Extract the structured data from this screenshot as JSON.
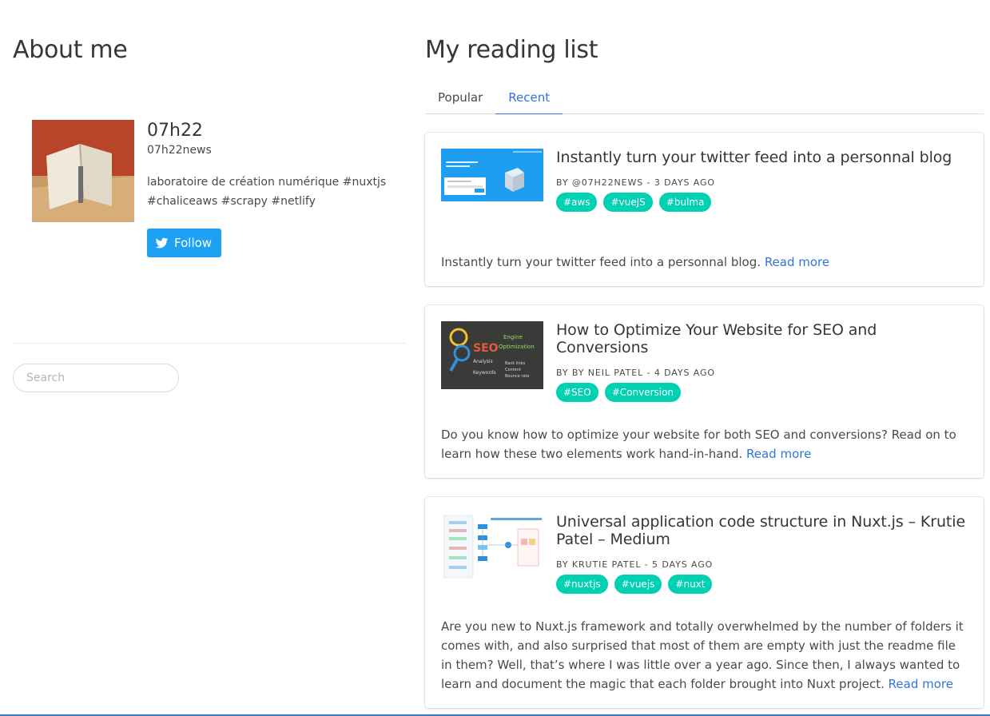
{
  "about": {
    "title": "About me",
    "name": "07h22",
    "handle": "07h22news",
    "bio": "laboratoire de création numérique #nuxtjs #chaliceaws #scrapy #netlify",
    "follow_label": "Follow",
    "search_placeholder": "Search"
  },
  "reading": {
    "title": "My reading list",
    "tabs": [
      {
        "label": "Popular",
        "active": false
      },
      {
        "label": "Recent",
        "active": true
      }
    ],
    "articles": [
      {
        "title": "Instantly turn your twitter feed into a personnal blog",
        "meta": "BY @07H22NEWS - 3 DAYS AGO",
        "tags": [
          "#aws",
          "#vueJS",
          "#bulma"
        ],
        "summary": "Instantly turn your twitter feed into a personnal blog.",
        "read_more": "Read more",
        "thumb_icon": "blue-box-thumbnail"
      },
      {
        "title": "How to Optimize Your Website for SEO and Conversions",
        "meta": "BY BY NEIL PATEL - 4 DAYS AGO",
        "tags": [
          "#SEO",
          "#Conversion"
        ],
        "summary": "Do you know how to optimize your website for both SEO and conversions? Read on to learn how these two elements work hand-in-hand.",
        "read_more": "Read more",
        "thumb_icon": "seo-chalkboard-thumbnail"
      },
      {
        "title": "Universal application code structure in Nuxt.js – Krutie Patel – Medium",
        "meta": "BY KRUTIE PATEL - 5 DAYS AGO",
        "tags": [
          "#nuxtjs",
          "#vuejs",
          "#nuxt"
        ],
        "summary": "Are you new to Nuxt.js framework and totally overwhelmed by the number of folders it comes with, and also surprised that most of them are empty with just the readme file in them? Well, that’s where I was little over a year ago. Since then, I always wanted to learn and document the magic that each folder brought into Nuxt project.",
        "read_more": "Read more",
        "thumb_icon": "diagram-thumbnail"
      }
    ]
  },
  "colors": {
    "tag": "#00d1b2",
    "link": "#3273dc",
    "twitter": "#1da1f2"
  }
}
